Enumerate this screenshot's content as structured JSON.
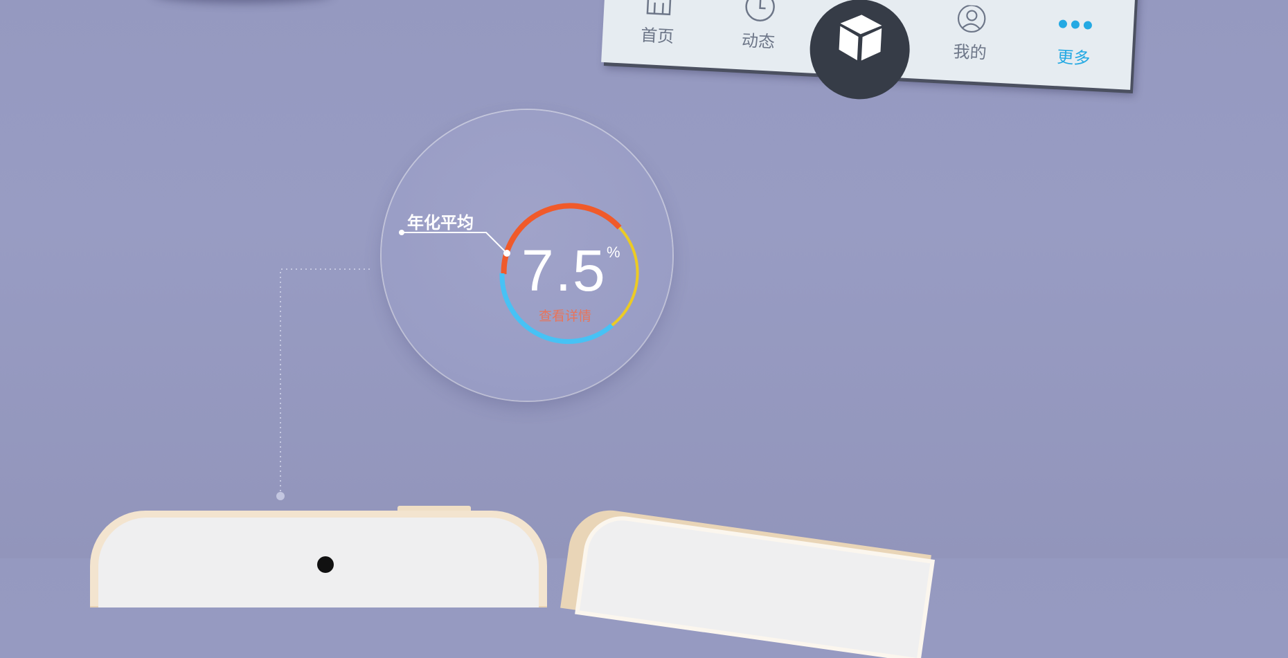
{
  "tabbar": {
    "items": [
      {
        "label": "首页",
        "icon": "home-icon"
      },
      {
        "label": "动态",
        "icon": "clock-icon"
      },
      {
        "label": "我的",
        "icon": "user-icon"
      },
      {
        "label": "更多",
        "icon": "more-icon",
        "active": true
      }
    ],
    "center_icon": "box-icon",
    "active_color": "#24a9e3"
  },
  "gauge": {
    "value": "7.5",
    "unit": "%",
    "sublabel": "查看详情",
    "annotation": "年化平均",
    "colors": {
      "orange": "#f05a2a",
      "yellow": "#eccb24",
      "blue": "#47c2f5"
    }
  }
}
